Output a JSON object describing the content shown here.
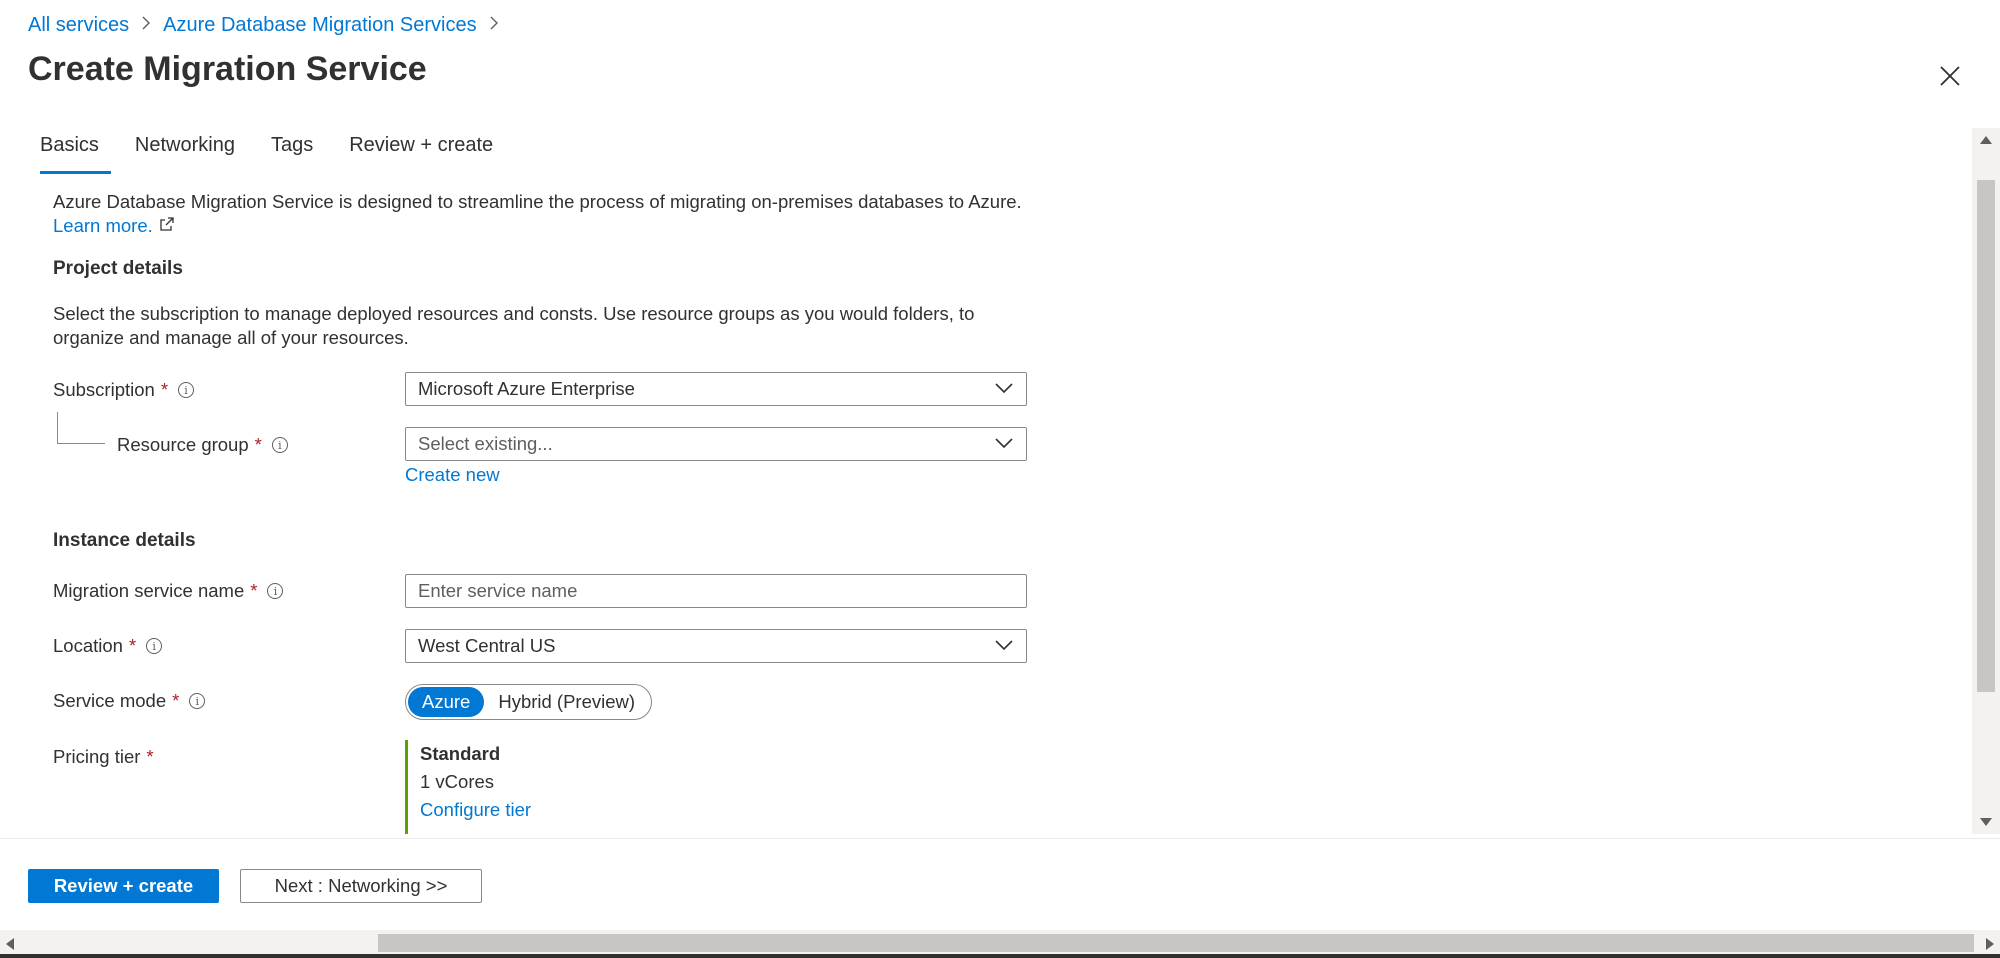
{
  "breadcrumb": {
    "items": [
      "All services",
      "Azure Database Migration Services"
    ]
  },
  "page": {
    "title": "Create Migration Service"
  },
  "tabs": [
    {
      "label": "Basics",
      "active": true
    },
    {
      "label": "Networking",
      "active": false
    },
    {
      "label": "Tags",
      "active": false
    },
    {
      "label": "Review + create",
      "active": false
    }
  ],
  "intro": {
    "text": "Azure Database Migration Service is designed to streamline the process of migrating on-premises databases to Azure.",
    "learn_more": "Learn more."
  },
  "project_details": {
    "heading": "Project details",
    "description": "Select the subscription to manage deployed resources and consts. Use resource groups as you would folders, to organize and manage all of your resources.",
    "subscription": {
      "label": "Subscription",
      "value": "Microsoft Azure Enterprise"
    },
    "resource_group": {
      "label": "Resource group",
      "placeholder": "Select existing...",
      "create_new": "Create new"
    }
  },
  "instance_details": {
    "heading": "Instance details",
    "service_name": {
      "label": "Migration service name",
      "placeholder": "Enter service name"
    },
    "location": {
      "label": "Location",
      "value": "West Central US"
    },
    "service_mode": {
      "label": "Service mode",
      "options": [
        "Azure",
        "Hybrid (Preview)"
      ],
      "selected": "Azure"
    },
    "pricing_tier": {
      "label": "Pricing tier",
      "tier": "Standard",
      "cores": "1 vCores",
      "configure": "Configure tier"
    }
  },
  "required_marker": "*",
  "footer": {
    "primary": "Review + create",
    "secondary": "Next : Networking >>"
  },
  "colors": {
    "accent": "#0078d4",
    "required": "#a4262c",
    "pricing_bar": "#57a300"
  }
}
